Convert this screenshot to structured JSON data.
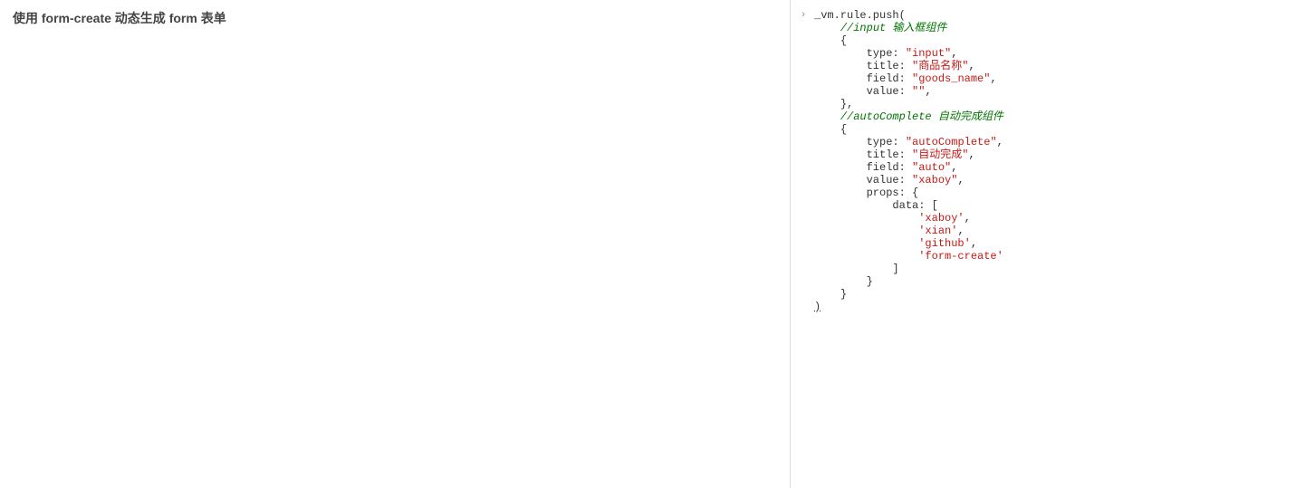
{
  "left": {
    "title": "使用 form-create 动态生成 form 表单"
  },
  "console": {
    "arrow": "›",
    "line_call": "_vm.rule.push(",
    "comment_input": "//input 输入框组件",
    "brace_open": "{",
    "kv_type_key": "type: ",
    "kv_title_key": "title: ",
    "kv_field_key": "field: ",
    "kv_value_key": "value: ",
    "kv_props_key": "props: {",
    "kv_data_key": "data: [",
    "input_type": "\"input\"",
    "input_title": "\"商品名称\"",
    "input_field": "\"goods_name\"",
    "input_value": "\"\"",
    "comma": ",",
    "brace_close_comma": "},",
    "comment_auto": "//autoComplete 自动完成组件",
    "auto_type": "\"autoComplete\"",
    "auto_title": "\"自动完成\"",
    "auto_field": "\"auto\"",
    "auto_value": "\"xaboy\"",
    "data_0": "'xaboy'",
    "data_1": "'xian'",
    "data_2": "'github'",
    "data_3": "'form-create'",
    "bracket_close": "]",
    "brace_close": "}",
    "paren_close": ")"
  }
}
